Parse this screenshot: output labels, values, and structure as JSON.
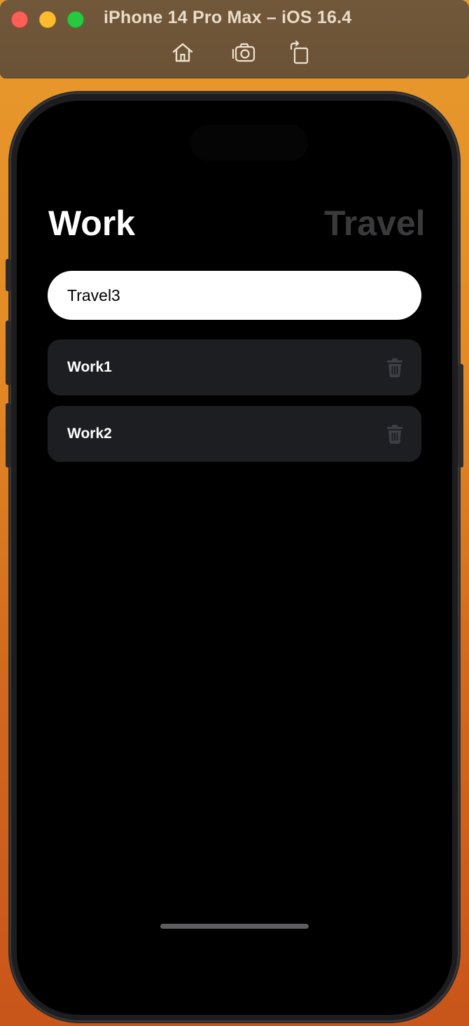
{
  "window": {
    "title": "iPhone 14 Pro Max – iOS 16.4",
    "toolbar": [
      {
        "icon": "home-icon"
      },
      {
        "icon": "camera-icon"
      },
      {
        "icon": "rotate-icon"
      }
    ]
  },
  "app": {
    "tabs": {
      "active": "Work",
      "inactive": "Travel"
    },
    "input": {
      "value": "Travel3"
    },
    "items": [
      {
        "label": "Work1",
        "icon": "trash-icon"
      },
      {
        "label": "Work2",
        "icon": "trash-icon"
      }
    ]
  },
  "colors": {
    "active_tab": "#ffffff",
    "inactive_tab": "#3a3a3c",
    "item_background": "#1c1e22",
    "screen_background": "#000000"
  }
}
